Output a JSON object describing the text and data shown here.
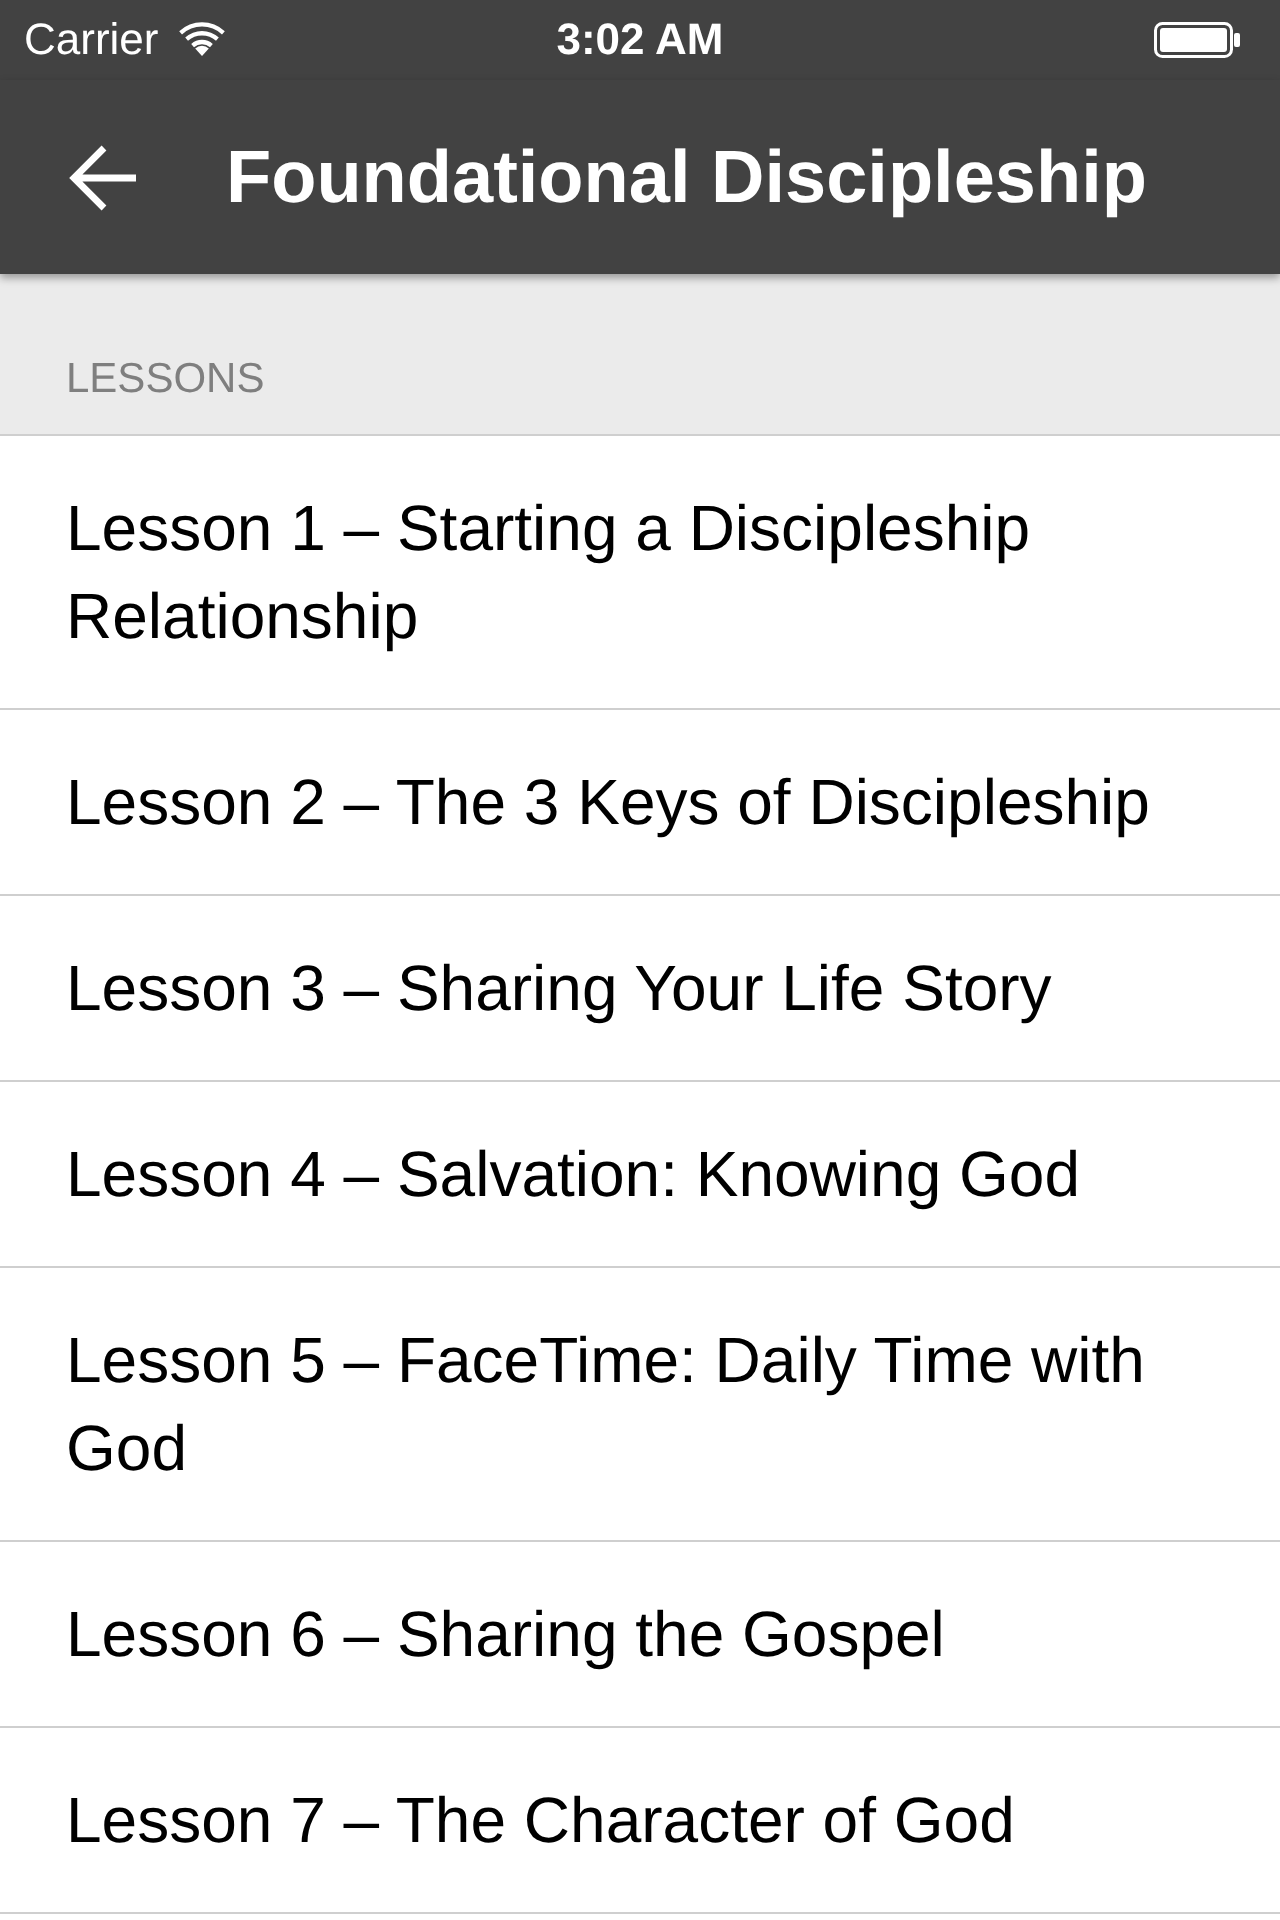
{
  "status_bar": {
    "carrier": "Carrier",
    "time": "3:02 AM"
  },
  "nav_bar": {
    "title": "Foundational Discipleship"
  },
  "section": {
    "header": "LESSONS"
  },
  "lessons": [
    {
      "title": "Lesson 1 – Starting a Discipleship Relationship"
    },
    {
      "title": "Lesson 2 – The 3 Keys of Discipleship"
    },
    {
      "title": "Lesson 3 – Sharing Your Life Story"
    },
    {
      "title": "Lesson 4 – Salvation: Knowing God"
    },
    {
      "title": "Lesson 5 – FaceTime: Daily Time with God"
    },
    {
      "title": "Lesson 6 – Sharing the Gospel"
    },
    {
      "title": "Lesson 7 – The Character of God"
    }
  ]
}
